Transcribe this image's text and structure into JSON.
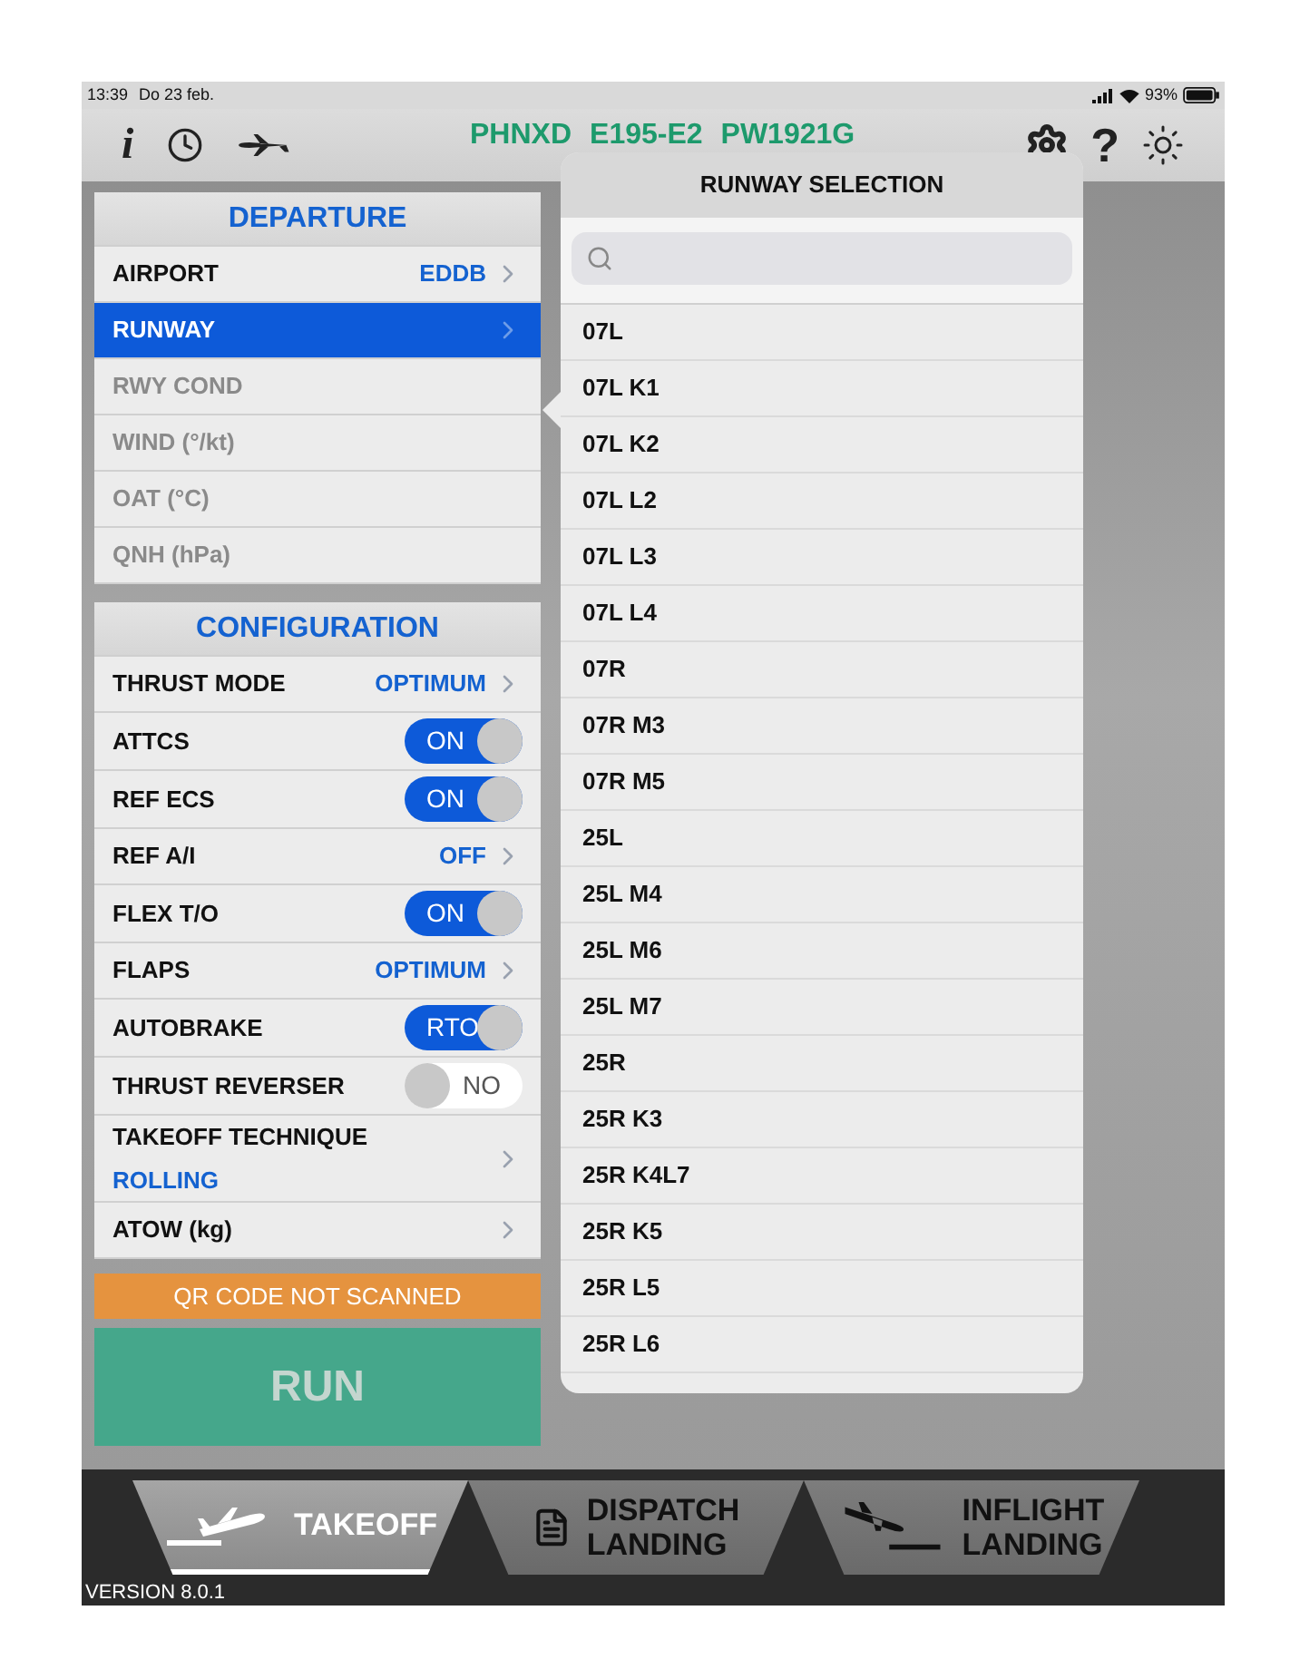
{
  "status_bar": {
    "time": "13:39",
    "date": "Do 23 feb.",
    "battery": "93%"
  },
  "toolbar": {
    "info_glyph": "i",
    "help_glyph": "?",
    "aircraft": [
      "PHNXD",
      "E195-E2",
      "PW1921G"
    ]
  },
  "departure": {
    "title": "DEPARTURE",
    "rows": [
      {
        "kind": "value",
        "label": "AIRPORT",
        "value": "EDDB",
        "disabled": false,
        "selected": false
      },
      {
        "kind": "value",
        "label": "RUNWAY",
        "disabled": false,
        "selected": true
      },
      {
        "kind": "value",
        "label": "RWY COND",
        "disabled": true,
        "selected": false
      },
      {
        "kind": "value",
        "label": "WIND (°/kt)",
        "disabled": true,
        "selected": false
      },
      {
        "kind": "value",
        "label": "OAT (°C)",
        "disabled": true,
        "selected": false
      },
      {
        "kind": "value",
        "label": "QNH (hPa)",
        "disabled": true,
        "selected": false
      }
    ]
  },
  "configuration": {
    "title": "CONFIGURATION",
    "rows": [
      {
        "kind": "value",
        "label": "THRUST MODE",
        "value": "OPTIMUM",
        "disabled": false,
        "selected": false
      },
      {
        "kind": "toggle",
        "label": "ATTCS",
        "value": "ON",
        "on": true
      },
      {
        "kind": "toggle",
        "label": "REF ECS",
        "value": "ON",
        "on": true
      },
      {
        "kind": "value",
        "label": "REF A/I",
        "value": "OFF",
        "disabled": false,
        "selected": false
      },
      {
        "kind": "toggle",
        "label": "FLEX T/O",
        "value": "ON",
        "on": true
      },
      {
        "kind": "value",
        "label": "FLAPS",
        "value": "OPTIMUM",
        "disabled": false,
        "selected": false
      },
      {
        "kind": "toggle",
        "label": "AUTOBRAKE",
        "value": "RTO",
        "on": true
      },
      {
        "kind": "toggle",
        "label": "THRUST REVERSER",
        "value": "NO",
        "on": false
      },
      {
        "kind": "subvalue",
        "label": "TAKEOFF TECHNIQUE",
        "value": "ROLLING"
      },
      {
        "kind": "value",
        "label": "ATOW (kg)",
        "disabled": false,
        "selected": false
      }
    ]
  },
  "qr_status": "QR CODE NOT SCANNED",
  "run_button": {
    "label": "RUN",
    "disabled": true
  },
  "runway_selection": {
    "title": "RUNWAY SELECTION",
    "runways": [
      "07L",
      "07L K1",
      "07L K2",
      "07L L2",
      "07L L3",
      "07L L4",
      "07R",
      "07R M3",
      "07R M5",
      "25L",
      "25L M4",
      "25L M6",
      "25L M7",
      "25R",
      "25R K3",
      "25R K4L7",
      "25R K5",
      "25R L5",
      "25R L6"
    ]
  },
  "tabs": [
    {
      "kind": "takeoff",
      "lines": [
        "TAKEOFF"
      ],
      "selected": true
    },
    {
      "kind": "dispatch",
      "lines": [
        "DISPATCH",
        "LANDING"
      ],
      "selected": false
    },
    {
      "kind": "inflight",
      "lines": [
        "INFLIGHT",
        "LANDING"
      ],
      "selected": false
    }
  ],
  "version": "VERSION 8.0.1"
}
